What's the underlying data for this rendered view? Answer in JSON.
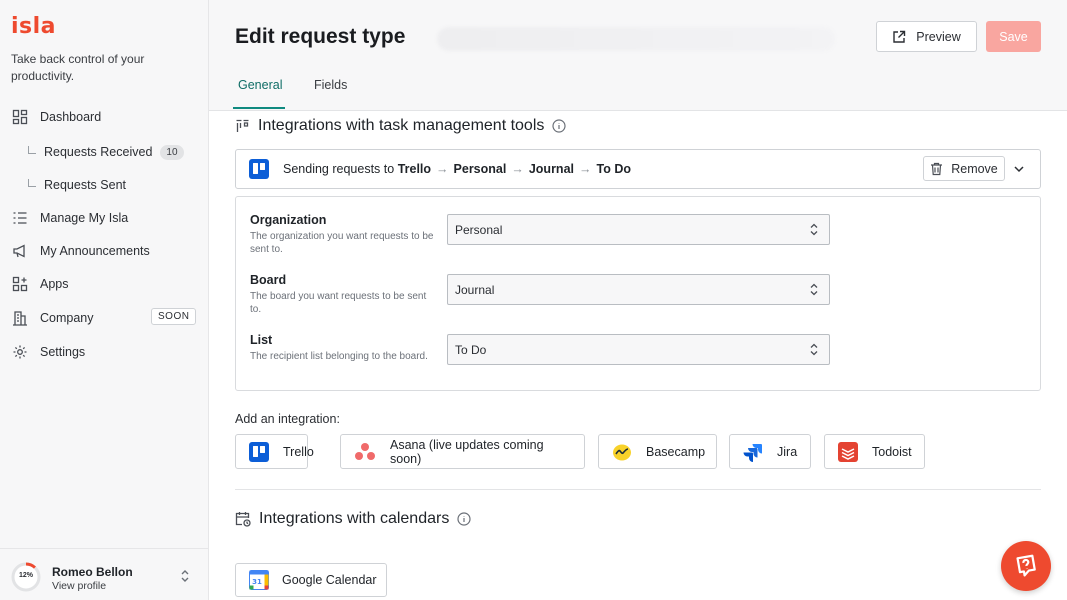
{
  "app": {
    "logo": "isla",
    "tagline": "Take back control of your productivity."
  },
  "sidebar": {
    "items": [
      {
        "label": "Dashboard",
        "icon": "dashboard-grid-icon"
      },
      {
        "label": "Requests Received",
        "badge": "10",
        "sub": true
      },
      {
        "label": "Requests Sent",
        "sub": true
      },
      {
        "label": "Manage My Isla",
        "icon": "checklist-icon"
      },
      {
        "label": "My Announcements",
        "icon": "megaphone-icon"
      },
      {
        "label": "Apps",
        "icon": "apps-icon"
      },
      {
        "label": "Company",
        "icon": "building-icon",
        "badge": "SOON"
      },
      {
        "label": "Settings",
        "icon": "gear-icon"
      }
    ],
    "profile": {
      "name": "Romeo Bellon",
      "link": "View profile",
      "progress_label": "12%",
      "progress": 0.12
    }
  },
  "header": {
    "title": "Edit request type",
    "preview_label": "Preview",
    "save_label": "Save",
    "tabs": [
      {
        "label": "General",
        "active": true
      },
      {
        "label": "Fields",
        "active": false
      }
    ]
  },
  "task_integrations": {
    "title": "Integrations with task management tools",
    "summary_prefix": "Sending requests to",
    "path": [
      "Trello",
      "Personal",
      "Journal",
      "To Do"
    ],
    "remove_label": "Remove",
    "fields": [
      {
        "label": "Organization",
        "description": "The organization you want requests to be sent to.",
        "value": "Personal"
      },
      {
        "label": "Board",
        "description": "The board you want requests to be sent to.",
        "value": "Journal"
      },
      {
        "label": "List",
        "description": "The recipient list belonging to the board.",
        "value": "To Do"
      }
    ],
    "add_label": "Add an integration:",
    "options": [
      {
        "label": "Trello",
        "icon": "trello-icon"
      },
      {
        "label": "Asana (live updates coming soon)",
        "icon": "asana-icon"
      },
      {
        "label": "Basecamp",
        "icon": "basecamp-icon"
      },
      {
        "label": "Jira",
        "icon": "jira-icon"
      },
      {
        "label": "Todoist",
        "icon": "todoist-icon"
      }
    ]
  },
  "calendar_integrations": {
    "title": "Integrations with calendars",
    "google_label": "Google Calendar",
    "google_icon_text": "31"
  },
  "colors": {
    "brand": "#ee4a2f",
    "accent": "#0f8a80",
    "save_disabled": "#f9a6a0",
    "trello": "#0c5ed7"
  }
}
